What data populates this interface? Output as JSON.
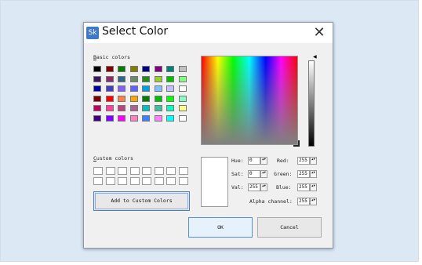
{
  "dialog": {
    "title": "Select Color",
    "app_icon_text": "Sk",
    "close_glyph": "✕",
    "basic_colors_label": {
      "mnemonic": "B",
      "rest": "asic colors"
    },
    "custom_colors_label": {
      "mnemonic": "C",
      "rest": "ustom colors"
    },
    "add_custom_label": "Add to Custom Colors",
    "ok_label": "OK",
    "cancel_label": "Cancel"
  },
  "basic_colors": [
    [
      "#000000",
      "#800000",
      "#008000",
      "#808000",
      "#000080",
      "#800080",
      "#008080",
      "#c0c0c0"
    ],
    [
      "#3c1a5a",
      "#8a2c6a",
      "#2c6a8a",
      "#6a8a6a",
      "#228b22",
      "#9acd32",
      "#00c000",
      "#80ff80"
    ],
    [
      "#0000a0",
      "#4040c0",
      "#8060ff",
      "#6060ff",
      "#00a0e0",
      "#80c0ff",
      "#c0c0ff",
      "#ffffff"
    ],
    [
      "#800000",
      "#ff0000",
      "#ff8040",
      "#ffa500",
      "#008000",
      "#00c000",
      "#00ff00",
      "#80ffc0"
    ],
    [
      "#c00060",
      "#ff40a0",
      "#c04080",
      "#b06090",
      "#00c0c0",
      "#40c0a0",
      "#00ffc0",
      "#ffff80"
    ],
    [
      "#400080",
      "#8000ff",
      "#ff00ff",
      "#ff80c0",
      "#4080ff",
      "#ff80ff",
      "#00ffff",
      "#ffffff"
    ]
  ],
  "custom_colors_count": 16,
  "fields": {
    "hue": {
      "label": "Hue:",
      "mnemonic": "H",
      "value": "0"
    },
    "sat": {
      "label": "Sat:",
      "mnemonic": "S",
      "value": "0"
    },
    "val": {
      "label": "Val:",
      "mnemonic": "V",
      "value": "255"
    },
    "red": {
      "label": "Red:",
      "mnemonic": "R",
      "value": "255"
    },
    "green": {
      "label": "Green:",
      "mnemonic": "G",
      "value": "255"
    },
    "blue": {
      "label": "Blue:",
      "mnemonic": "u",
      "value": "255"
    },
    "alpha": {
      "label": "Alpha channel:",
      "mnemonic": "A",
      "value": "255"
    }
  },
  "spin_arrows": "▲▼"
}
